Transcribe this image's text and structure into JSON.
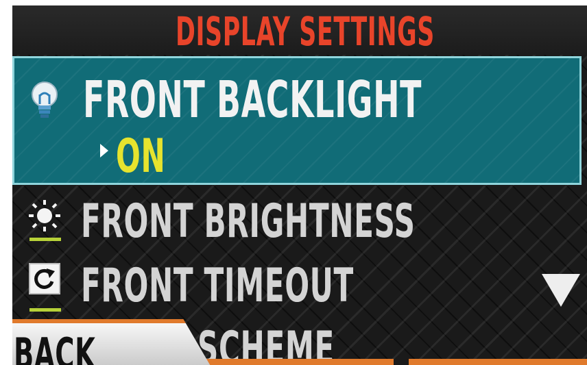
{
  "header": {
    "title": "DISPLAY SETTINGS"
  },
  "menu": {
    "items": [
      {
        "label": "FRONT BACKLIGHT",
        "icon": "lightbulb-icon",
        "value": "ON",
        "selected": true
      },
      {
        "label": "FRONT BRIGHTNESS",
        "icon": "sun-icon"
      },
      {
        "label": "FRONT TIMEOUT",
        "icon": "refresh-icon"
      },
      {
        "label": "SCHEME",
        "icon": ""
      }
    ]
  },
  "footer": {
    "back_label": "BACK"
  },
  "icons": {
    "scroll": "triangle-down-icon",
    "value_pointer": "triangle-right-icon"
  },
  "colors": {
    "title": "#e8442a",
    "selected_row": "#116c77",
    "selected_value": "#e6e32e",
    "accent_bar": "#e07a2c",
    "icon_underline": "#b7d238"
  }
}
